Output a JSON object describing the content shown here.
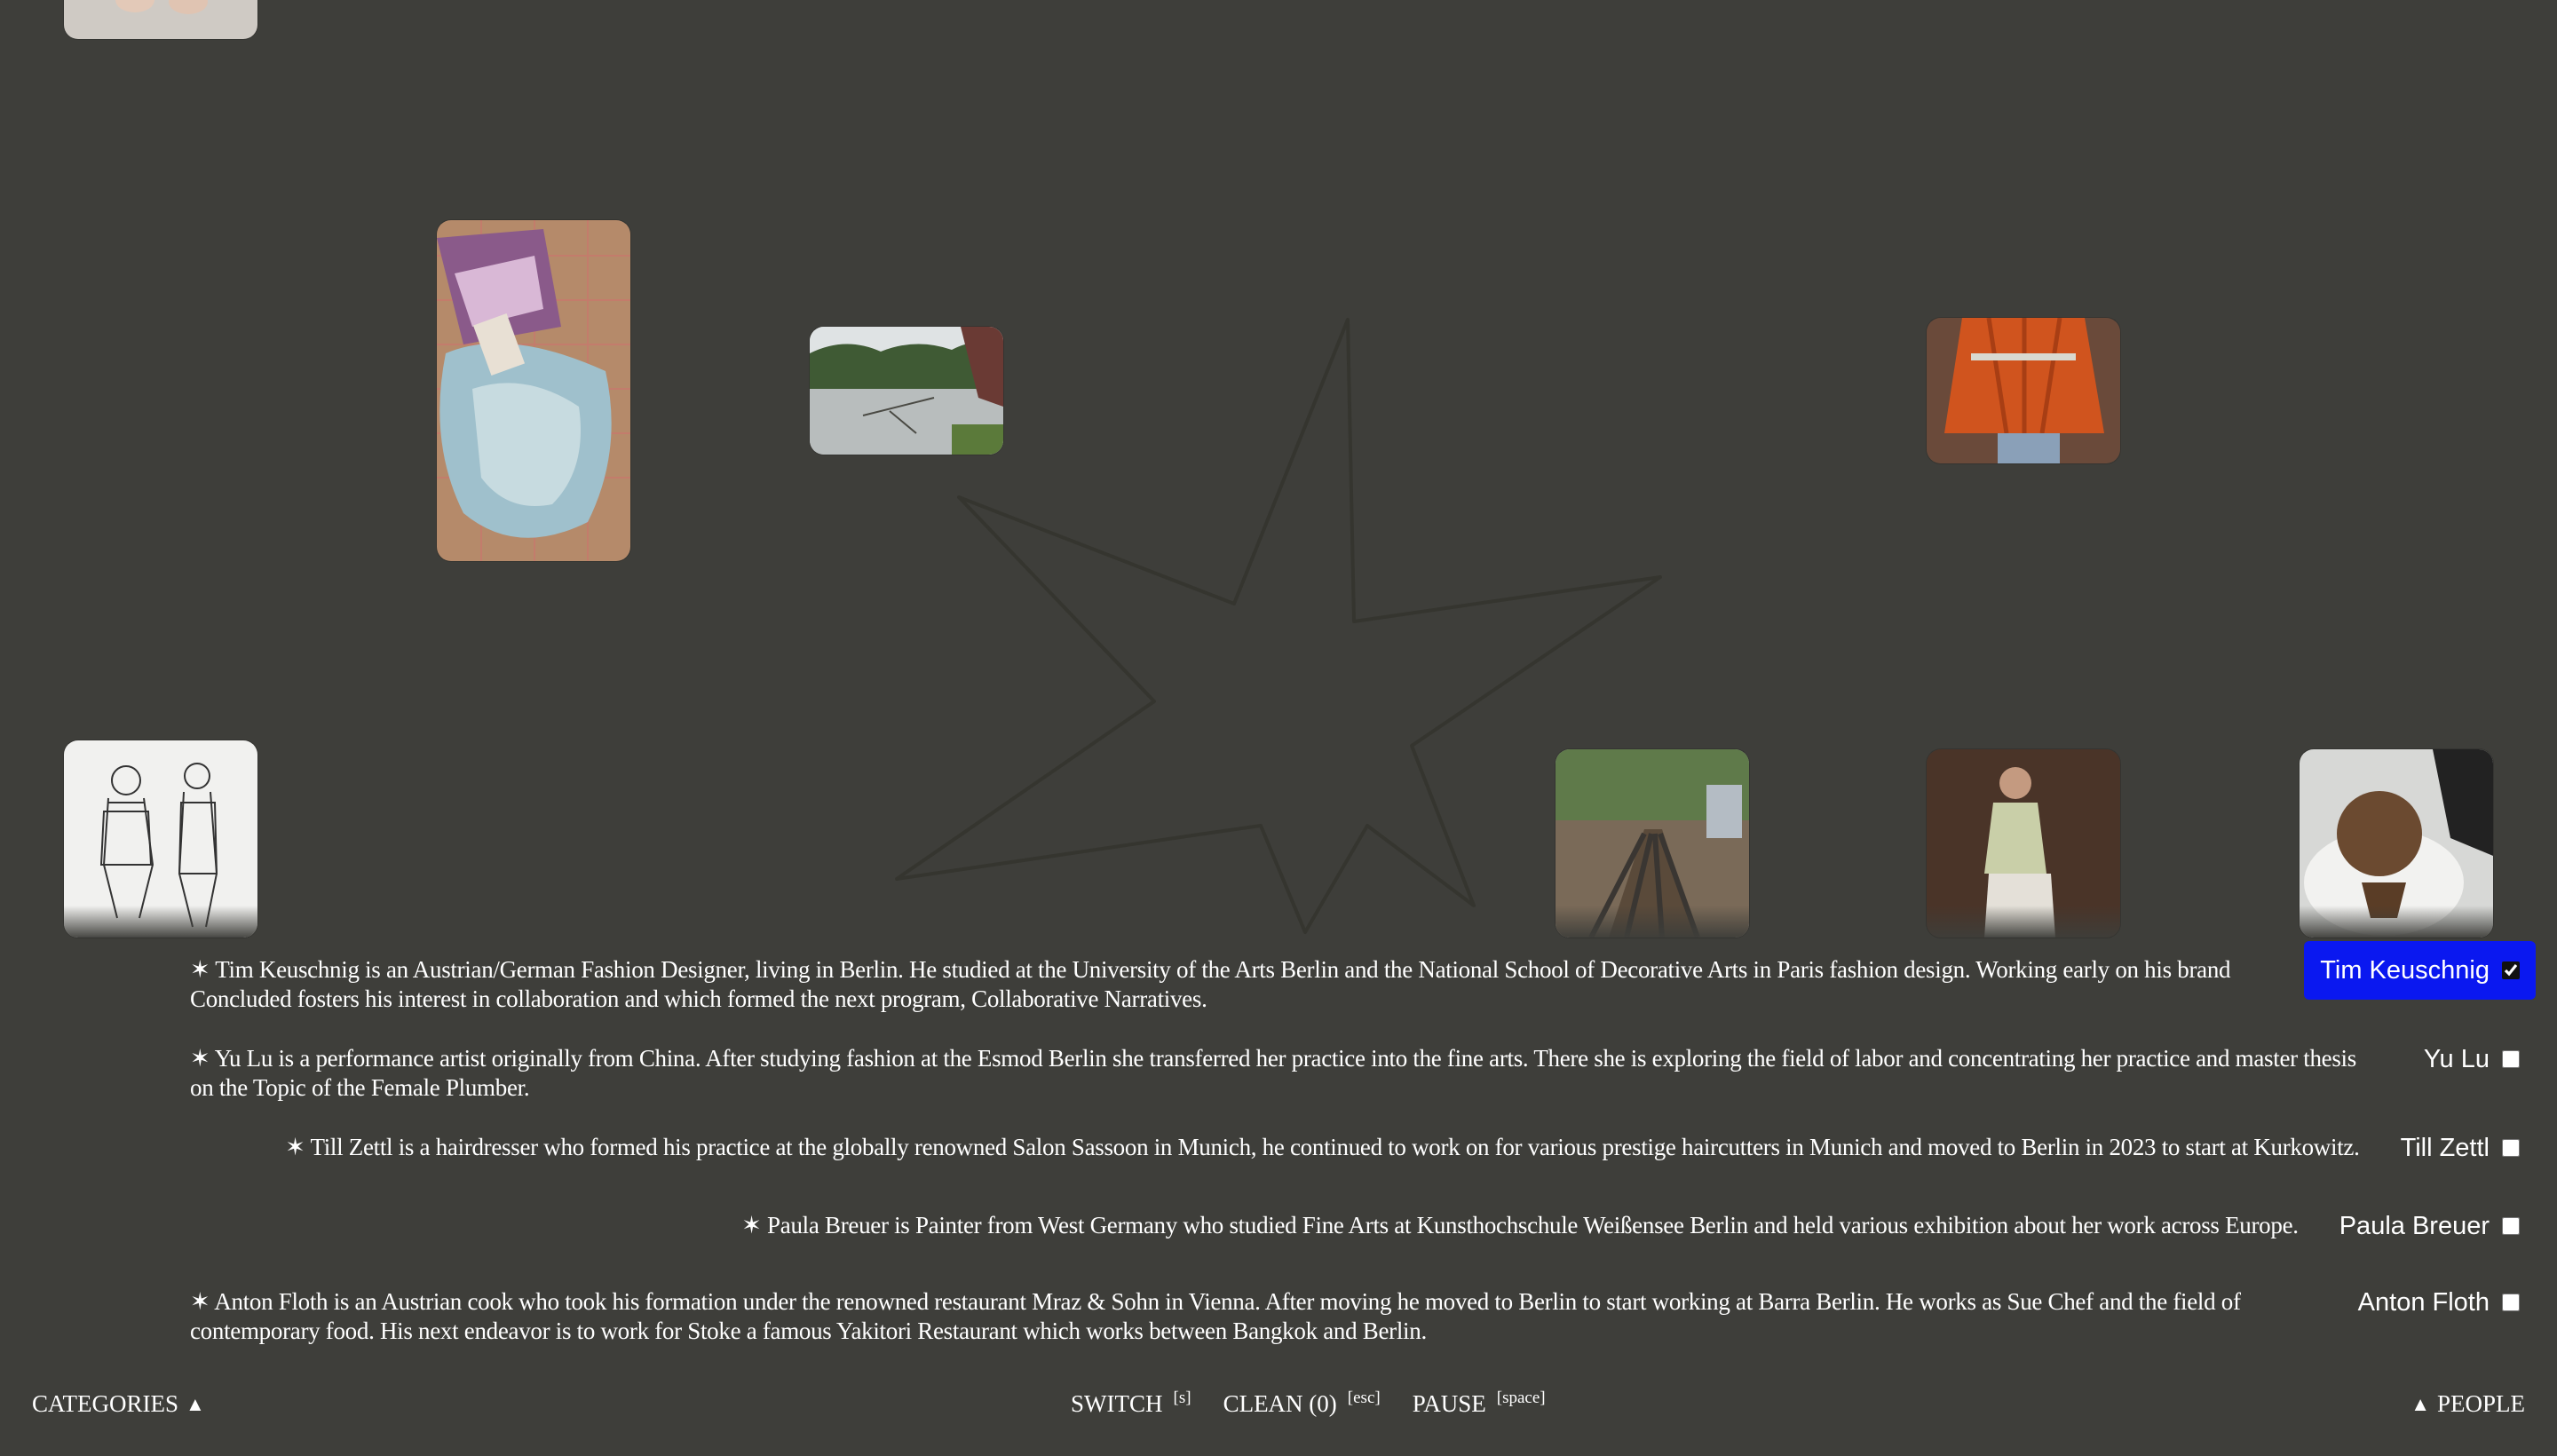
{
  "colors": {
    "background": "#3e3e3a",
    "active_chip": "#0a18f0",
    "text": "#ffffff"
  },
  "people": [
    {
      "bio": "✶ Tim Keuschnig is an Austrian/German Fashion Designer, living in Berlin. He studied at the University of the Arts Berlin and the National School of Decorative Arts in Paris fashion design. Working early on his brand Concluded fosters his interest in collaboration and which formed the next program, Collaborative Narratives.",
      "name": "Tim Keuschnig",
      "selected": true
    },
    {
      "bio": "✶ Yu Lu is a performance artist originally from China. After studying fashion at the Esmod Berlin she transferred her practice into the fine arts. There she is exploring the field of labor and concentrating her practice and master thesis on the Topic of the Female Plumber.",
      "name": "Yu Lu",
      "selected": false
    },
    {
      "bio": "✶ Till Zettl is a hairdresser who formed his practice at the globally renowned Salon Sassoon in Munich, he continued to work on for various prestige haircutters in Munich and moved to Berlin in 2023 to start at Kurkowitz.",
      "name": "Till Zettl",
      "selected": false
    },
    {
      "bio": "✶ Paula Breuer is Painter from West Germany who studied Fine Arts at Kunsthochschule Weißensee Berlin and held various exhibition about her work across Europe.",
      "name": "Paula Breuer",
      "selected": false
    },
    {
      "bio": "✶ Anton Floth is an Austrian cook who took his formation under the renowned restaurant Mraz & Sohn in Vienna. After moving he moved to Berlin to start working at Barra Berlin. He works as Sue Chef and the field of contemporary food. His next endeavor is to work for Stoke a famous Yakitori Restaurant which works between Bangkok and Berlin.",
      "name": "Anton Floth",
      "selected": false
    }
  ],
  "bottom_bar": {
    "categories_label": "CATEGORIES",
    "categories_icon": "triangle-up-icon",
    "switch_label": "SWITCH",
    "switch_key": "[s]",
    "clean_label": "CLEAN (0)",
    "clean_key": "[esc]",
    "pause_label": "PAUSE",
    "pause_key": "[space]",
    "people_label": "PEOPLE",
    "people_icon": "triangle-up-icon"
  },
  "thumbnails": [
    {
      "subject": "feet-photo"
    },
    {
      "subject": "textile-collage-photo"
    },
    {
      "subject": "lake-photo"
    },
    {
      "subject": "orange-garment-photo"
    },
    {
      "subject": "fashion-sketch"
    },
    {
      "subject": "pipes-construction-photo"
    },
    {
      "subject": "portrait-photo"
    },
    {
      "subject": "haircut-photo"
    }
  ]
}
